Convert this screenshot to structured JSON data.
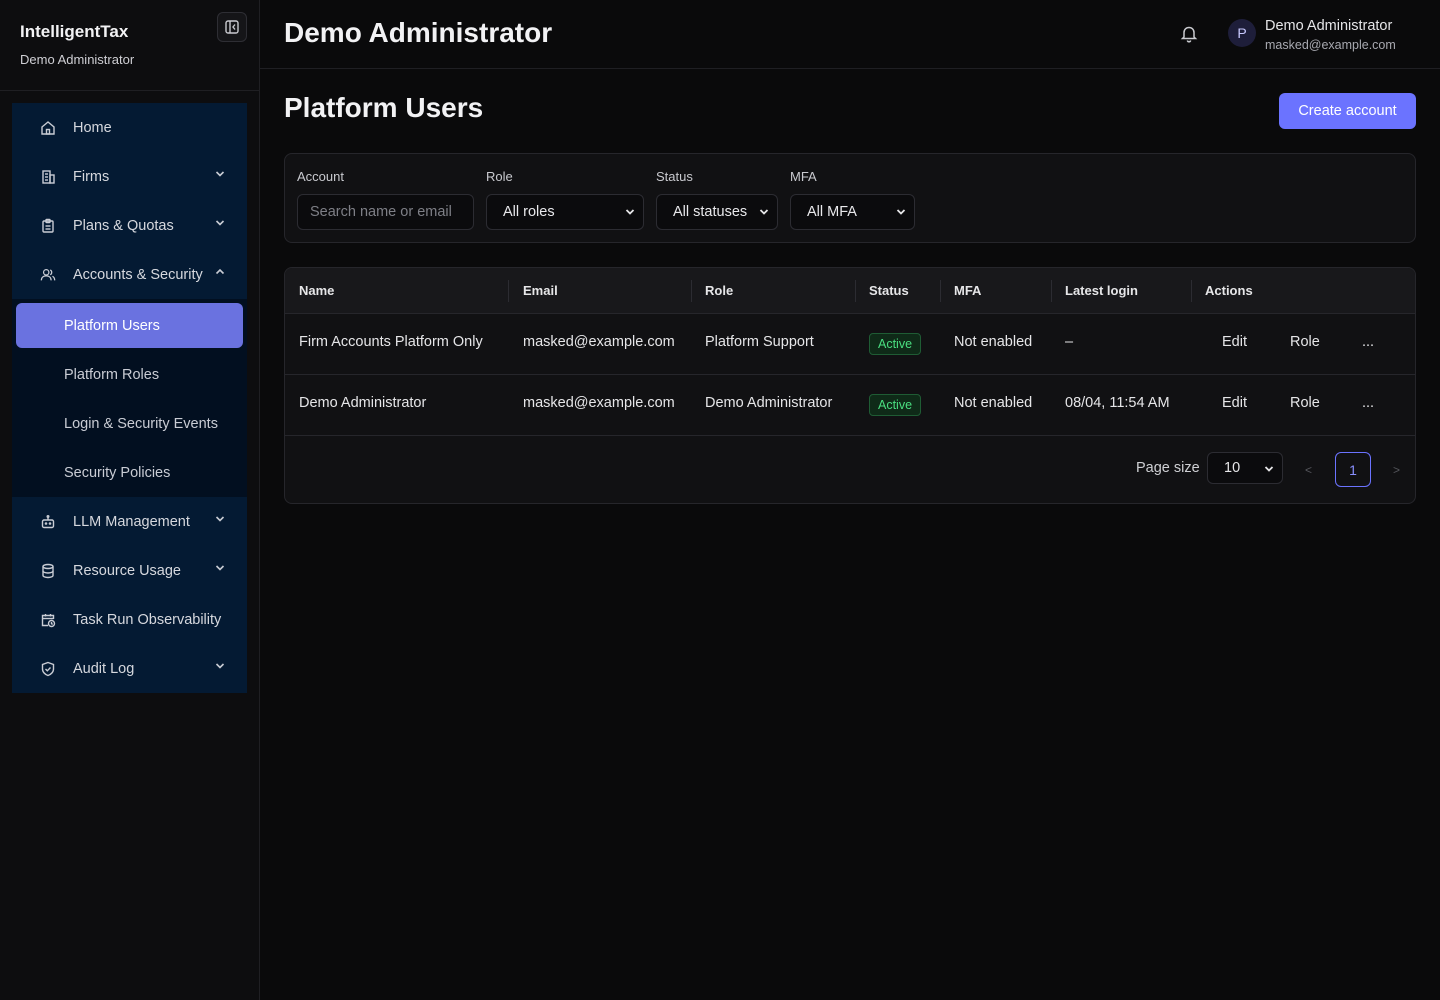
{
  "sidebar": {
    "brand": "IntelligentTax",
    "brand_sub": "Demo Administrator",
    "items": [
      {
        "label": "Home",
        "icon": "home-icon"
      },
      {
        "label": "Firms",
        "icon": "building-icon"
      },
      {
        "label": "Plans & Quotas",
        "icon": "clipboard-icon"
      },
      {
        "label": "Accounts & Security",
        "icon": "users-icon"
      },
      {
        "label": "LLM Management",
        "icon": "robot-icon"
      },
      {
        "label": "Resource Usage",
        "icon": "database-icon"
      },
      {
        "label": "Task Run Observability",
        "icon": "calendar-clock-icon"
      },
      {
        "label": "Audit Log",
        "icon": "shield-check-icon"
      }
    ],
    "sub_items": [
      {
        "label": "Platform Users"
      },
      {
        "label": "Platform Roles"
      },
      {
        "label": "Login & Security Events"
      },
      {
        "label": "Security Policies"
      }
    ]
  },
  "header": {
    "title": "Demo Administrator",
    "avatar_initial": "P",
    "user_name": "Demo Administrator",
    "user_email": "masked@example.com"
  },
  "main": {
    "title": "Platform Users",
    "create_button": "Create account",
    "filters": {
      "account_label": "Account",
      "account_placeholder": "Search name or email",
      "role_label": "Role",
      "role_value": "All roles",
      "status_label": "Status",
      "status_value": "All statuses",
      "mfa_label": "MFA",
      "mfa_value": "All MFA"
    },
    "table": {
      "columns": [
        "Name",
        "Email",
        "Role",
        "Status",
        "MFA",
        "Latest login",
        "Actions"
      ],
      "rows": [
        {
          "name": "Firm Accounts Platform Only",
          "email": "masked@example.com",
          "role": "Platform Support",
          "status": "Active",
          "mfa": "Not enabled",
          "login": "–",
          "edit": "Edit",
          "role_action": "Role",
          "more": "..."
        },
        {
          "name": "Demo Administrator",
          "email": "masked@example.com",
          "role": "Demo Administrator",
          "status": "Active",
          "mfa": "Not enabled",
          "login": "08/04, 11:54 AM",
          "edit": "Edit",
          "role_action": "Role",
          "more": "..."
        }
      ]
    },
    "pagination": {
      "page_size_label": "Page size",
      "page_size": "10",
      "prev": "<",
      "current_page": "1",
      "next": ">"
    }
  },
  "colors": {
    "accent": "#6b73ff",
    "active_nav": "#6a72e0",
    "nav_bg": "#041a33",
    "status_active": "#4ade80"
  }
}
